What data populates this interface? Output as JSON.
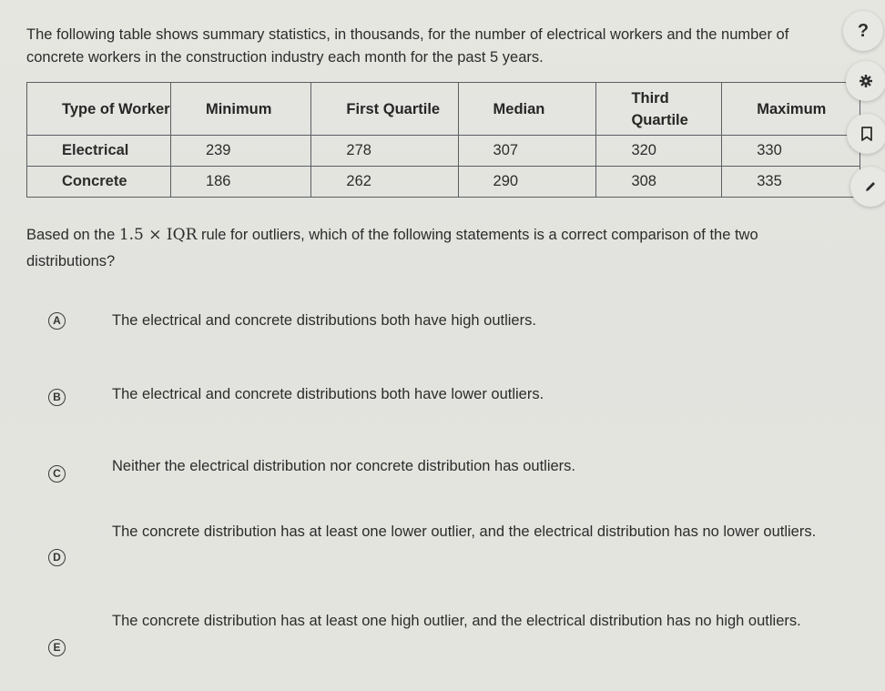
{
  "intro": "The following table shows summary statistics, in thousands, for the number of electrical workers and the number of concrete workers in the construction industry each month for the past 5 years.",
  "table": {
    "headers": [
      "Type of Worker",
      "Minimum",
      "First Quartile",
      "Median",
      "Third Quartile",
      "Maximum"
    ],
    "rows": [
      [
        "Electrical",
        "239",
        "278",
        "307",
        "320",
        "330"
      ],
      [
        "Concrete",
        "186",
        "262",
        "290",
        "308",
        "335"
      ]
    ]
  },
  "question": {
    "before": "Based on the ",
    "math": "1.5 × IQR",
    "after": " rule for outliers, which of the following statements is a correct comparison of the two distributions?"
  },
  "options": [
    {
      "letter": "A",
      "text": "The electrical and concrete distributions both have high outliers."
    },
    {
      "letter": "B",
      "text": "The electrical and concrete distributions both have lower outliers."
    },
    {
      "letter": "C",
      "text": "Neither the electrical distribution nor concrete distribution has outliers."
    },
    {
      "letter": "D",
      "text": "The concrete distribution has at least one lower outlier, and the electrical distribution has no lower outliers."
    },
    {
      "letter": "E",
      "text": "The concrete distribution has at least one high outlier, and the electrical distribution has no high outliers."
    }
  ],
  "toolbar": {
    "help_label": "?",
    "icons": [
      "help-icon",
      "gear-icon",
      "bookmark-icon",
      "pencil-icon"
    ]
  }
}
